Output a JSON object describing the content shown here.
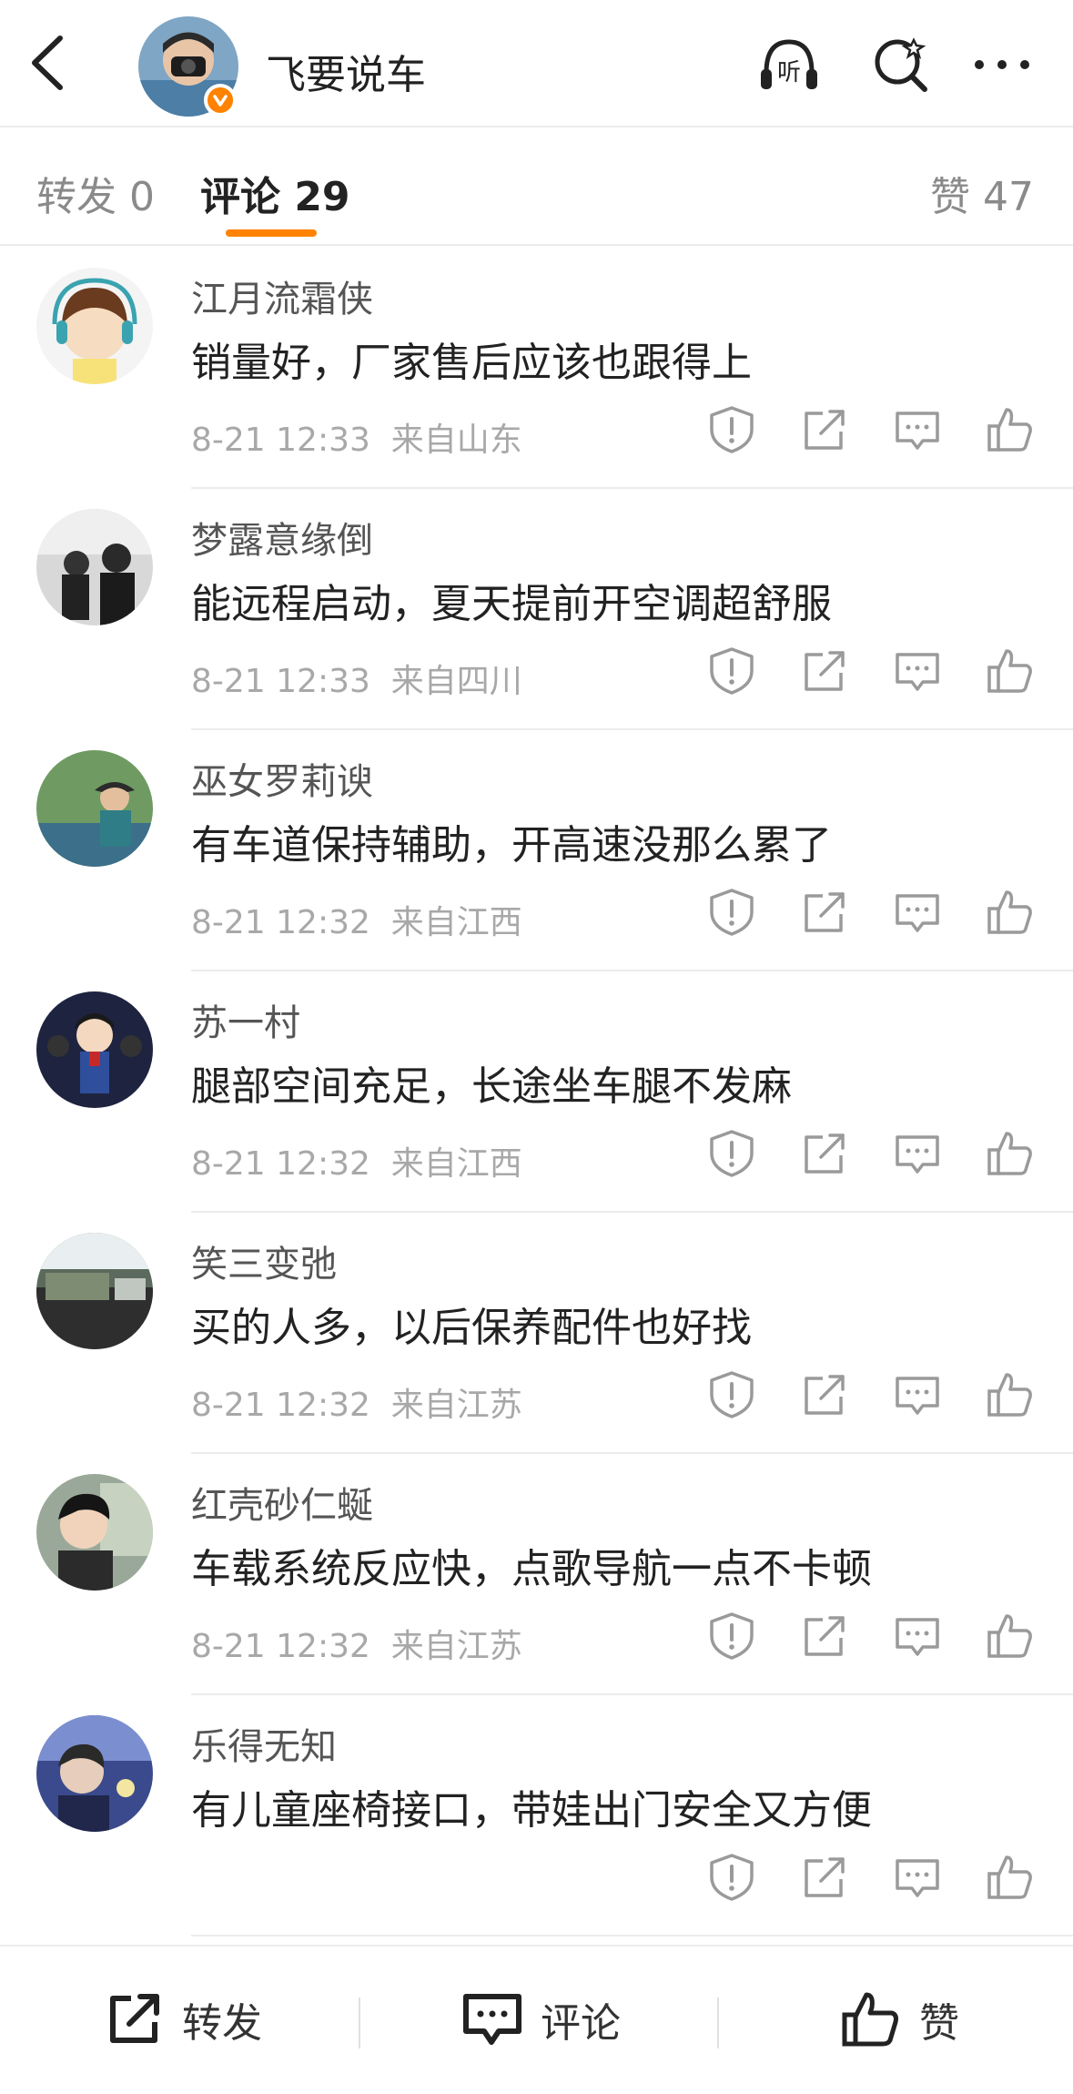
{
  "header": {
    "title": "飞要说车",
    "icons": [
      "back-arrow-icon",
      "listen-icon",
      "search-icon",
      "more-icon"
    ],
    "listen_label": "听"
  },
  "tabs": {
    "repost": "转发 0",
    "comment": "评论 29",
    "like": "赞 47"
  },
  "comments": [
    {
      "name": "江月流霜侠",
      "text": "销量好，厂家售后应该也跟得上",
      "time": "8-21 12:33",
      "source": "来自山东"
    },
    {
      "name": "梦露意缘倒",
      "text": "能远程启动，夏天提前开空调超舒服",
      "time": "8-21 12:33",
      "source": "来自四川"
    },
    {
      "name": "巫女罗莉谀",
      "text": "有车道保持辅助，开高速没那么累了",
      "time": "8-21 12:32",
      "source": "来自江西"
    },
    {
      "name": "苏一村",
      "text": "腿部空间充足，长途坐车腿不发麻",
      "time": "8-21 12:32",
      "source": "来自江西"
    },
    {
      "name": "笑三变弛",
      "text": "买的人多，以后保养配件也好找",
      "time": "8-21 12:32",
      "source": "来自江苏"
    },
    {
      "name": "红壳砂仁蜒",
      "text": "车载系统反应快，点歌导航一点不卡顿",
      "time": "8-21 12:32",
      "source": "来自江苏"
    },
    {
      "name": "乐得无知",
      "text": "有儿童座椅接口，带娃出门安全又方便",
      "time": "",
      "source": ""
    }
  ],
  "footer": {
    "repost_label": "转发",
    "comment_label": "评论",
    "like_label": "赞"
  },
  "colors": {
    "accent": "#ff8200",
    "verified_badge": "#ff8200"
  }
}
